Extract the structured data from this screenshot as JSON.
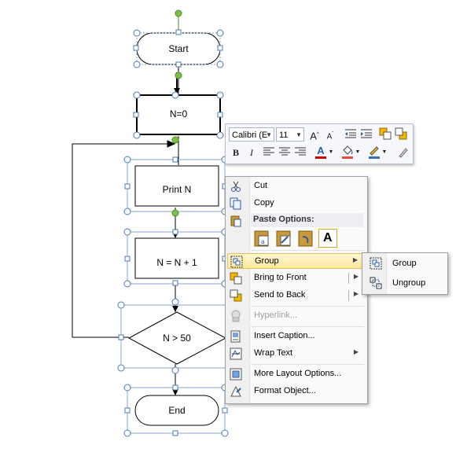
{
  "flowchart": {
    "start_label": "Start",
    "init_label": "N=0",
    "print_label": "Print N",
    "increment_label": "N = N + 1",
    "decision_label": "N > 50",
    "end_label": "End"
  },
  "mini_toolbar": {
    "font_name": "Calibri (E",
    "font_size": "11",
    "bold": "B",
    "italic": "I",
    "font_color_glyph": "A",
    "font_color": "#d00000",
    "fill_color": "#e74c3c",
    "line_color": "#3a6fbf"
  },
  "context_menu": {
    "cut": "Cut",
    "copy": "Copy",
    "paste_options_header": "Paste Options:",
    "paste_text_glyph": "A",
    "group": "Group",
    "bring_to_front": "Bring to Front",
    "send_to_back": "Send to Back",
    "hyperlink": "Hyperlink...",
    "insert_caption": "Insert Caption...",
    "wrap_text": "Wrap Text",
    "more_layout_options": "More Layout Options...",
    "format_object": "Format Object..."
  },
  "group_submenu": {
    "group": "Group",
    "ungroup": "Ungroup"
  },
  "colors": {
    "handle_green": "#7cc242",
    "handle_blue": "#4a78b8",
    "highlight": "#ffe79b"
  }
}
